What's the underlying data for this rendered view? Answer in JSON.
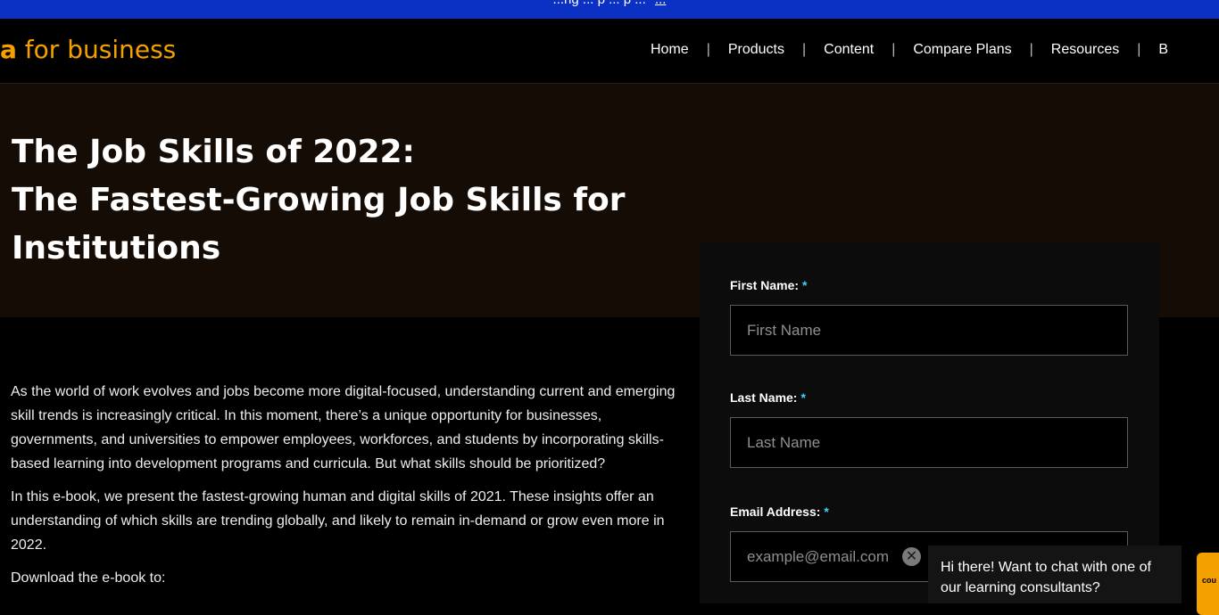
{
  "announcement": {
    "text": "...ng ... p ... p ...",
    "link": "..."
  },
  "brand": {
    "mark": "a",
    "text": " for business"
  },
  "nav": {
    "items": [
      "Home",
      "Products",
      "Content",
      "Compare Plans",
      "Resources",
      "B"
    ]
  },
  "hero": {
    "title_lines": [
      "The Job Skills of 2022:",
      "The Fastest-Growing Job Skills for",
      "Institutions"
    ]
  },
  "body": {
    "paragraphs": [
      "As the world of work evolves and jobs become more digital-focused, understanding current and emerging skill trends is increasingly critical. In this moment, there’s a unique opportunity for businesses, governments, and universities to empower employees, workforces, and students by incorporating skills-based learning into development programs and curricula. But what skills should be prioritized?",
      "In this e-book, we present the fastest-growing human and digital skills of 2021. These insights offer an understanding of which skills are trending globally, and likely to remain in-demand or grow even more in 2022.",
      "Download the e-book to:"
    ]
  },
  "form": {
    "first_name": {
      "label": "First Name:",
      "placeholder": "First Name"
    },
    "last_name": {
      "label": "Last Name:",
      "placeholder": "Last Name"
    },
    "email": {
      "label": "Email Address:",
      "placeholder": "example@email.com"
    },
    "required_marker": "*"
  },
  "chat": {
    "message": "Hi there! Want to chat with one of our learning consultants?",
    "close_glyph": "✕",
    "launcher_label": "cou"
  },
  "colors": {
    "accent": "#f4a100",
    "banner": "#0a30c4",
    "required": "#3bd1ff",
    "hero_bg": "#150d05"
  }
}
